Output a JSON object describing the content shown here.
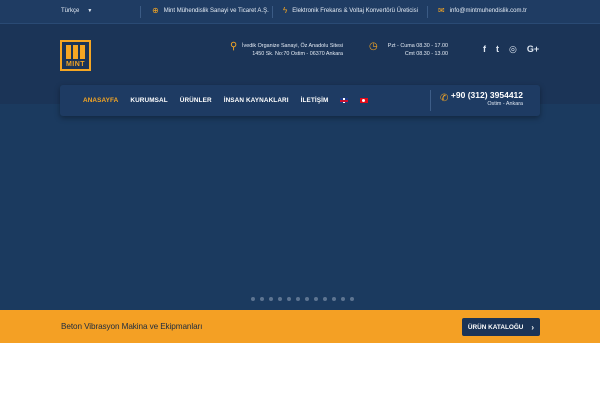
{
  "topbar": {
    "language": "Türkçe",
    "company": "Mint Mühendislik Sanayi ve Ticaret A.Ş.",
    "tagline": "Elektronik Frekans & Voltaj Konvertörü Üreticisi",
    "email": "info@mintmuhendislik.com.tr"
  },
  "logo": {
    "text": "MINT"
  },
  "header": {
    "address_line1": "İvedik Organize Sanayi, Öz Anadolu Sitesi",
    "address_line2": "1450 Sk. No:70 Ostim - 06370 Ankara",
    "hours_line1": "Pzt - Cuma 08.30 - 17.00",
    "hours_line2": "Cmt 08.30 - 13.00"
  },
  "social": {
    "facebook": "f",
    "twitter": "t",
    "instagram": "◎",
    "googleplus": "G+"
  },
  "nav": {
    "items": [
      "ANASAYFA",
      "KURUMSAL",
      "ÜRÜNLER",
      "İNSAN KAYNAKLARI",
      "İLETİŞİM"
    ],
    "phone": "+90 (312) 3954412",
    "phone_location": "Ostim - Ankara"
  },
  "slider": {
    "dot_count": 12
  },
  "cta": {
    "text": "Beton Vibrasyon Makina ve Ekipmanları",
    "button": "ÜRÜN KATALOĞU"
  },
  "colors": {
    "accent": "#f5a623",
    "navy": "#1b3457",
    "cta_bg": "#f4a024"
  }
}
